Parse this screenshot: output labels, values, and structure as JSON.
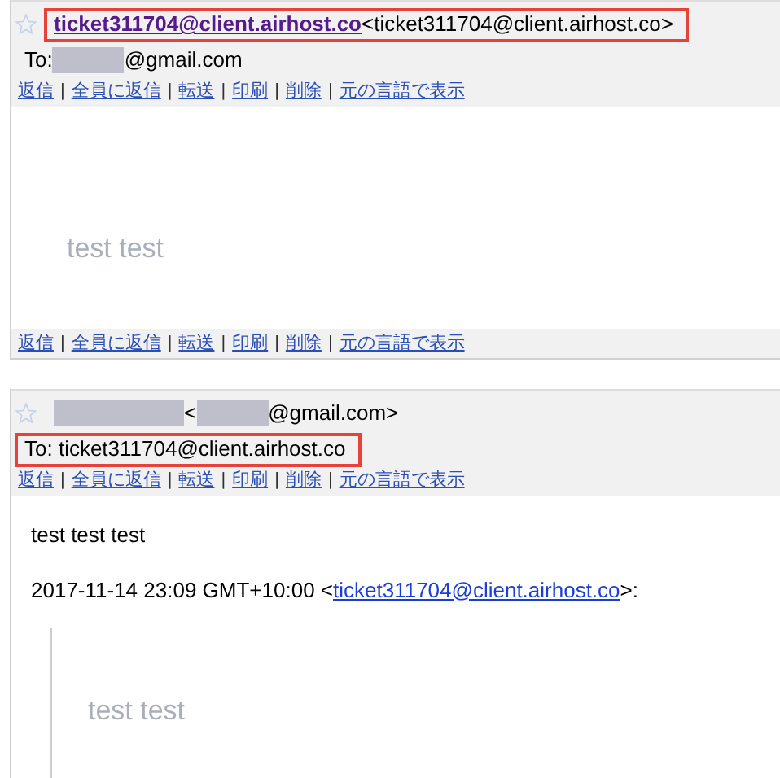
{
  "messages": [
    {
      "sender": {
        "highlighted": true,
        "parts": [
          {
            "kind": "link",
            "text": "ticket311704@client.airhost.co"
          },
          {
            "kind": "text",
            "text": "<ticket311704@client.airhost.co>"
          }
        ]
      },
      "to": {
        "highlighted": false,
        "parts": [
          {
            "kind": "text",
            "text": "To:"
          },
          {
            "kind": "redacted"
          },
          {
            "kind": "text",
            "text": "@gmail.com"
          }
        ]
      },
      "actions_top": [
        "返信",
        "全員に返信",
        "転送",
        "印刷",
        "削除",
        "元の言語で表示"
      ],
      "body": [
        {
          "kind": "faded",
          "text": "test test"
        }
      ],
      "actions_bottom": [
        "返信",
        "全員に返信",
        "転送",
        "印刷",
        "削除",
        "元の言語で表示"
      ]
    },
    {
      "sender": {
        "highlighted": false,
        "parts": [
          {
            "kind": "redacted-wide"
          },
          {
            "kind": "text",
            "text": "<"
          },
          {
            "kind": "redacted"
          },
          {
            "kind": "text",
            "text": "@gmail.com>"
          }
        ]
      },
      "to": {
        "highlighted": true,
        "parts": [
          {
            "kind": "text",
            "text": "To: ticket311704@client.airhost.co"
          }
        ]
      },
      "actions_top": [
        "返信",
        "全員に返信",
        "転送",
        "印刷",
        "削除",
        "元の言語で表示"
      ],
      "body": [
        {
          "kind": "text",
          "text": "test test test"
        },
        {
          "kind": "attribution",
          "parts": [
            {
              "kind": "text",
              "text": "2017-11-14 23:09 GMT+10:00 <"
            },
            {
              "kind": "link",
              "text": "ticket311704@client.airhost.co"
            },
            {
              "kind": "text",
              "text": ">:"
            }
          ]
        },
        {
          "kind": "quote",
          "children": [
            {
              "kind": "faded",
              "text": "test test"
            }
          ]
        }
      ]
    }
  ],
  "separator": "|"
}
